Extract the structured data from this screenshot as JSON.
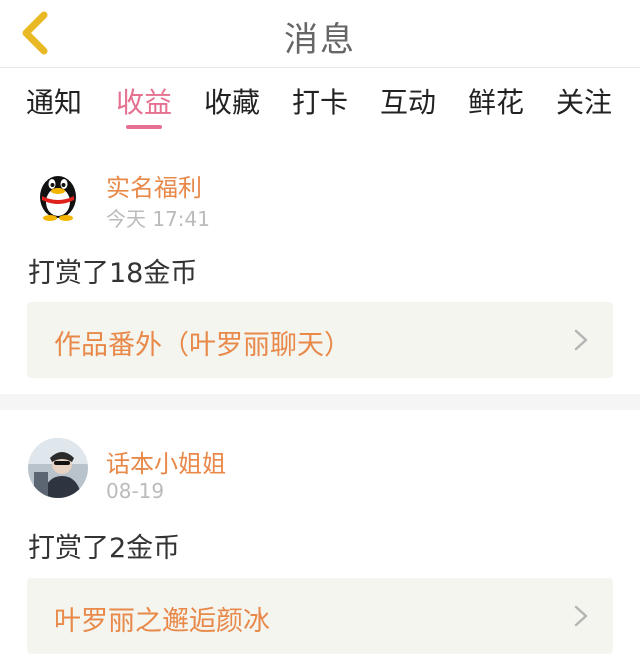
{
  "header": {
    "title": "消息"
  },
  "tabs": [
    {
      "label": "通知"
    },
    {
      "label": "收益",
      "active": true
    },
    {
      "label": "收藏"
    },
    {
      "label": "打卡"
    },
    {
      "label": "互动"
    },
    {
      "label": "鲜花"
    },
    {
      "label": "关注"
    }
  ],
  "messages": [
    {
      "sender": "实名福利",
      "time": "今天 17:41",
      "text": "打赏了18金币",
      "work_title": "作品番外（叶罗丽聊天）",
      "avatar": "qq-penguin-icon"
    },
    {
      "sender": "话本小姐姐",
      "time": "08-19",
      "text": "打赏了2金币",
      "work_title": "叶罗丽之邂逅颜冰",
      "avatar": "user-photo"
    }
  ],
  "colors": {
    "accent": "#e5708f",
    "sender": "#e8894a",
    "back_arrow": "#e8b923"
  }
}
